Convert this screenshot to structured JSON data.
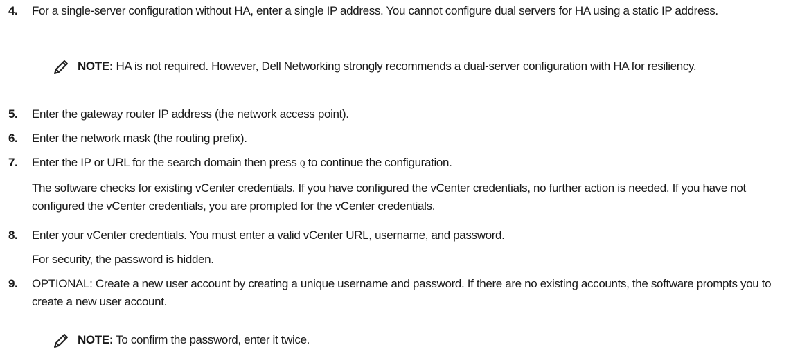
{
  "steps": {
    "s4": {
      "num": "4.",
      "text": "For a single-server configuration without HA, enter a single IP address. You cannot configure dual servers for HA using a static IP address."
    },
    "note1": {
      "label": "NOTE:",
      "text": " HA is not required. However, Dell Networking strongly recommends a dual-server configuration with HA for resiliency."
    },
    "s5": {
      "num": "5.",
      "text": "Enter the gateway router IP address (the network access point)."
    },
    "s6": {
      "num": "6.",
      "text": "Enter the network mask (the routing prefix)."
    },
    "s7": {
      "num": "7.",
      "text_before": "Enter the IP or URL for the search domain then press ",
      "key": "Q",
      "text_after": " to continue the configuration.",
      "sub": "The software checks for existing vCenter credentials. If you have configured the vCenter credentials, no further action is needed. If you have not configured the vCenter credentials, you are prompted for the vCenter credentials."
    },
    "s8": {
      "num": "8.",
      "text": "Enter your vCenter credentials. You must enter a valid vCenter URL, username, and password.",
      "sub": "For security, the password is hidden."
    },
    "s9": {
      "num": "9.",
      "text": "OPTIONAL: Create a new user account by creating a unique username and password. If there are no existing accounts, the software prompts you to create a new user account."
    },
    "note2": {
      "label": "NOTE:",
      "text": " To confirm the password, enter it twice."
    }
  },
  "icons": {
    "note": "pencil-note-icon"
  }
}
